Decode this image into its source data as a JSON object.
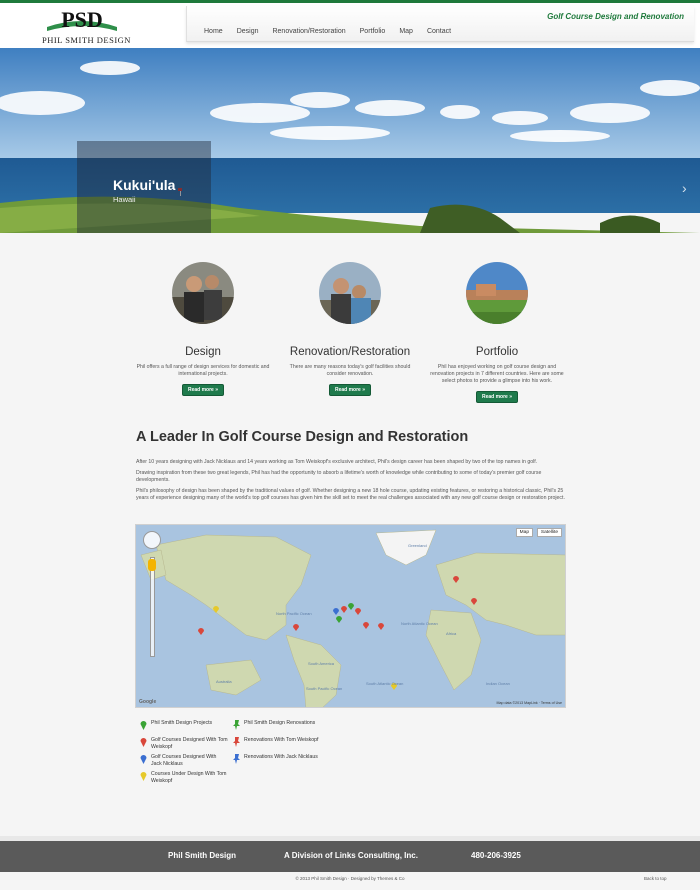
{
  "header": {
    "logo_mark": "PSD",
    "logo_text": "PHIL SMITH DESIGN",
    "tagline": "Golf Course Design and Renovation",
    "nav": [
      "Home",
      "Design",
      "Renovation/Restoration",
      "Portfolio",
      "Map",
      "Contact"
    ]
  },
  "hero": {
    "title": "Kukui'ula",
    "subtitle": "Hawaii",
    "next_icon": "chevron-right-icon"
  },
  "services": [
    {
      "title": "Design",
      "description": "Phil offers a full range of design services for domestic and international projects.",
      "button": "Read more »"
    },
    {
      "title": "Renovation/Restoration",
      "description": "There are many reasons today's golf facilities should consider renovation.",
      "button": "Read more »"
    },
    {
      "title": "Portfolio",
      "description": "Phil has enjoyed working on golf course design and renovation projects in 7 different countries. Here are some select photos to provide a glimpse into his work.",
      "button": "Read more »"
    }
  ],
  "intro": {
    "heading": "A Leader In Golf Course Design and Restoration",
    "paragraphs": [
      "After 10 years designing with Jack Nicklaus and 14 years working as Tom Weiskopf's exclusive architect, Phil's design career has been shaped by two of the top names in golf.",
      "Drawing inspiration from these two great legends, Phil has had the opportunity to absorb a lifetime's worth of knowledge while contributing to some of today's premier golf course developments.",
      "Phil's philosophy of design has been shaped by the traditional values of golf. Whether designing a new 18 hole course, updating existing features, or restoring a historical classic, Phil's 25 years of experience designing many of the world's top golf courses has given him the skill set to meet the real challenges associated with any new golf course design or restoration project."
    ]
  },
  "map": {
    "type_map": "Map",
    "type_satellite": "Satellite",
    "footer": "Map data ©2013 MapLink · Terms of Use",
    "google": "Google",
    "labels": [
      "Greenland",
      "North Pacific Ocean",
      "North Atlantic Ocean",
      "South Pacific Ocean",
      "South Atlantic Ocean",
      "Indian Ocean",
      "Australia",
      "South America",
      "Africa"
    ]
  },
  "legend": [
    {
      "label": "Phil Smith Design Projects",
      "color": "#3aa335"
    },
    {
      "label": "Golf Courses Designed With Tom Weiskopf",
      "color": "#d9473b"
    },
    {
      "label": "Golf Courses Designed With Jack Nicklaus",
      "color": "#3b6fd1"
    },
    {
      "label": "Courses Under Design With Tom Weiskopf",
      "color": "#e6c92a"
    },
    {
      "label": "Phil Smith Design Renovations",
      "color": "#3aa335"
    },
    {
      "label": "Renovations With Tom Weiskopf",
      "color": "#d9473b"
    },
    {
      "label": "Renovations With Jack Nicklaus",
      "color": "#3b6fd1"
    }
  ],
  "footer": {
    "name": "Phil Smith Design",
    "division": "A Division of Links Consulting, Inc.",
    "phone": "480-206-3925",
    "copyright": "© 2013 Phil Smith Design · Designed by Themes & Co",
    "back_to_top": "Back to top"
  },
  "colors": {
    "brand_green": "#1f7a3c",
    "button_green": "#1f7a4c",
    "footer_gray": "#5a5a5a"
  }
}
